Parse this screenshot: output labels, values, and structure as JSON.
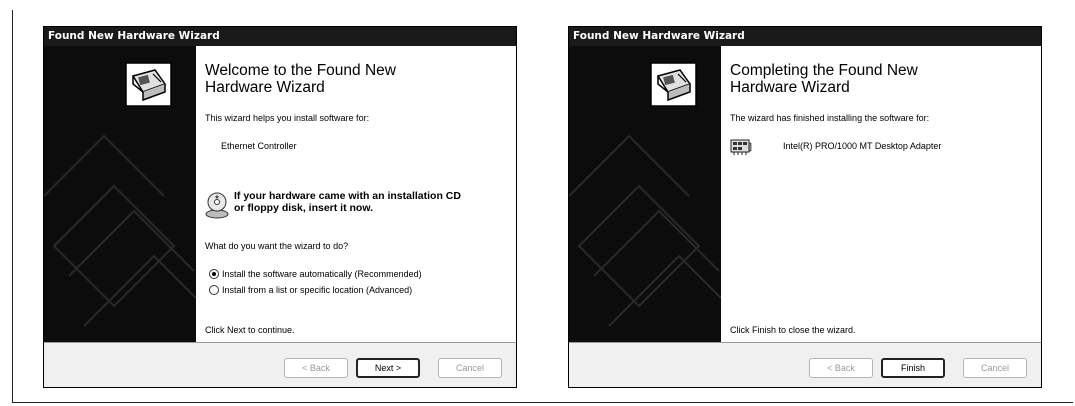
{
  "windows": [
    {
      "title": "Found New Hardware Wizard",
      "heading_line1": "Welcome to the Found New",
      "heading_line2": "Hardware Wizard",
      "intro": "This wizard helps you install software for:",
      "device": "Ethernet Controller",
      "cd_line1": "If your hardware came with an installation CD",
      "cd_line2": "or floppy disk, insert it now.",
      "question": "What do you want the wizard to do?",
      "options": [
        {
          "label": "Install the software automatically (Recommended)",
          "selected": true
        },
        {
          "label": "Install from a list or specific location (Advanced)",
          "selected": false
        }
      ],
      "footer": "Click Next to continue.",
      "buttons": {
        "back": "< Back",
        "next": "Next >",
        "cancel": "Cancel"
      }
    },
    {
      "title": "Found New Hardware Wizard",
      "heading_line1": "Completing the Found New",
      "heading_line2": "Hardware Wizard",
      "intro": "The wizard has finished installing the software for:",
      "device": "Intel(R) PRO/1000 MT Desktop Adapter",
      "footer": "Click Finish to close the wizard.",
      "buttons": {
        "back": "< Back",
        "finish": "Finish",
        "cancel": "Cancel"
      }
    }
  ],
  "icons": {
    "wizard": "hardware-wizard-icon",
    "cd": "installation-cd-icon",
    "adapter": "network-adapter-icon"
  },
  "colors": {
    "titlebar": "#1a1a1a",
    "left_panel": "#0c0c0c",
    "footer_bar": "#f0f0f0"
  }
}
